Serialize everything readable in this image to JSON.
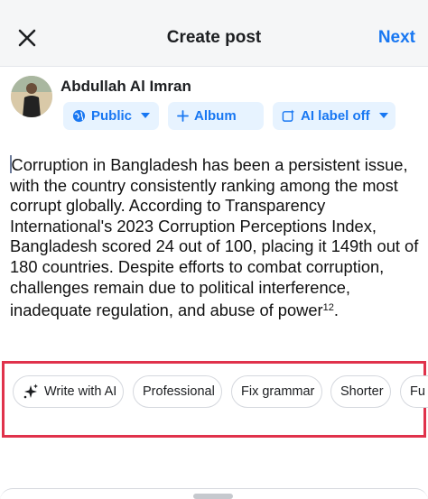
{
  "header": {
    "title": "Create post",
    "next_label": "Next"
  },
  "author": {
    "name": "Abdullah Al Imran"
  },
  "audience": {
    "public_label": "Public",
    "album_label": "Album",
    "ai_label": "AI label off"
  },
  "post": {
    "text": "Corruption in Bangladesh has been a persistent issue, with the country consistently ranking among the most corrupt globally. According to Transparency International's 2023 Corruption Perceptions Index, Bangladesh scored 24 out of 100, placing it 149th out of 180 countries. Despite efforts to combat corruption, challenges remain due to political interference, inadequate regulation, and abuse of power",
    "superscript": "12",
    "end": "."
  },
  "ai_chips": [
    {
      "label": "Write with AI"
    },
    {
      "label": "Professional"
    },
    {
      "label": "Fix grammar"
    },
    {
      "label": "Shorter"
    },
    {
      "label": "Fu"
    }
  ],
  "colors": {
    "accent": "#1877f2",
    "highlight": "#e0324b",
    "pill_bg": "#e7f3ff"
  },
  "icons": {
    "close": "close-icon",
    "globe": "globe-icon",
    "plus": "plus-icon",
    "ai_label": "ai-label-icon",
    "chevron": "chevron-down-icon",
    "sparkle": "sparkle-icon"
  }
}
